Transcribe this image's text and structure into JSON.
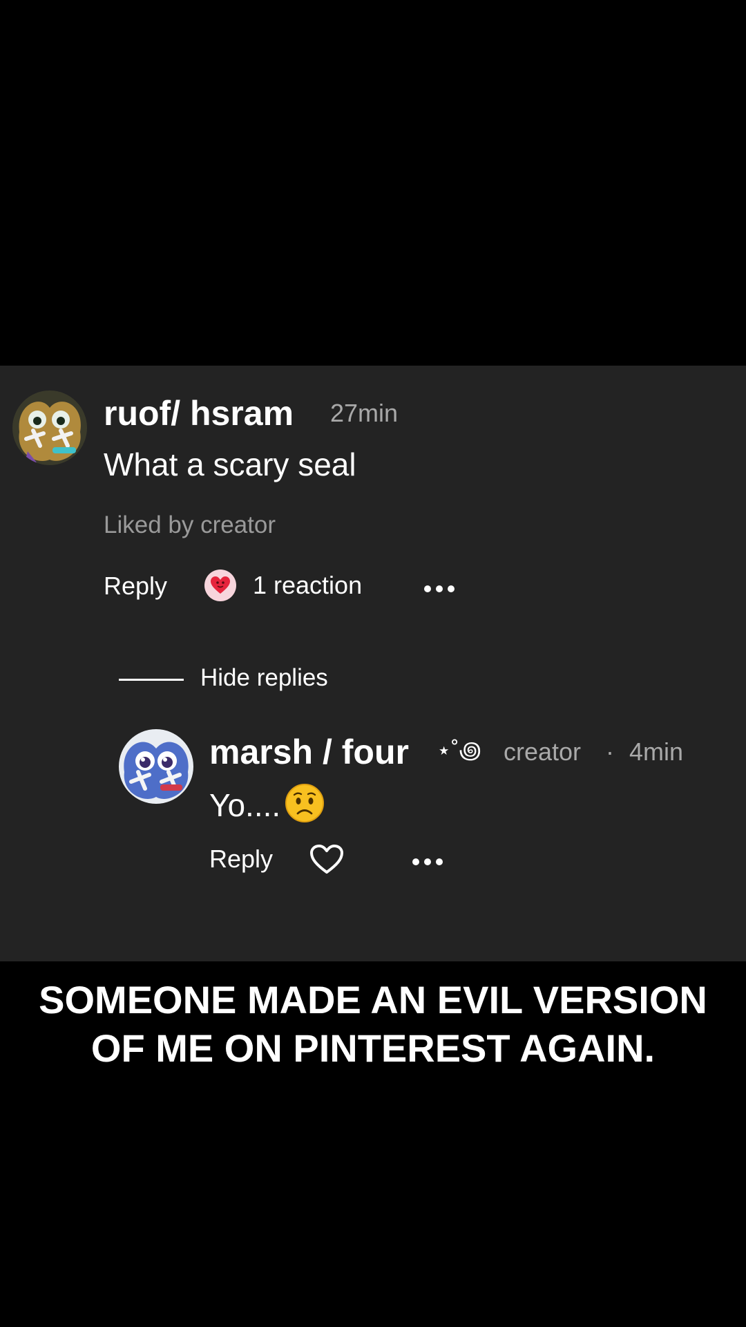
{
  "comment": {
    "username": "ruof/ hsram",
    "time": "27min",
    "text": "What a scary seal",
    "liked_by": "Liked by creator",
    "reply_label": "Reply",
    "reaction_count": "1 reaction",
    "reaction_icon": "heart-face-emoji"
  },
  "replies_toggle": {
    "label": "Hide replies"
  },
  "reply": {
    "username": "marsh / four",
    "decoration": "⋆˚꩜",
    "badge": "creator",
    "separator": "·",
    "time": "4min",
    "text": "Yo....",
    "emoji": "worried-face-emoji",
    "reply_label": "Reply",
    "like_icon": "heart-outline-icon"
  },
  "caption": {
    "line1": "SOMEONE MADE AN EVIL VERSION",
    "line2": "OF ME ON PINTEREST AGAIN."
  },
  "colors": {
    "panel_bg": "#232323",
    "page_bg": "#000000",
    "muted_text": "#a9a9a9",
    "reaction_circle": "#f7d5dc",
    "reaction_heart": "#e6243c"
  }
}
